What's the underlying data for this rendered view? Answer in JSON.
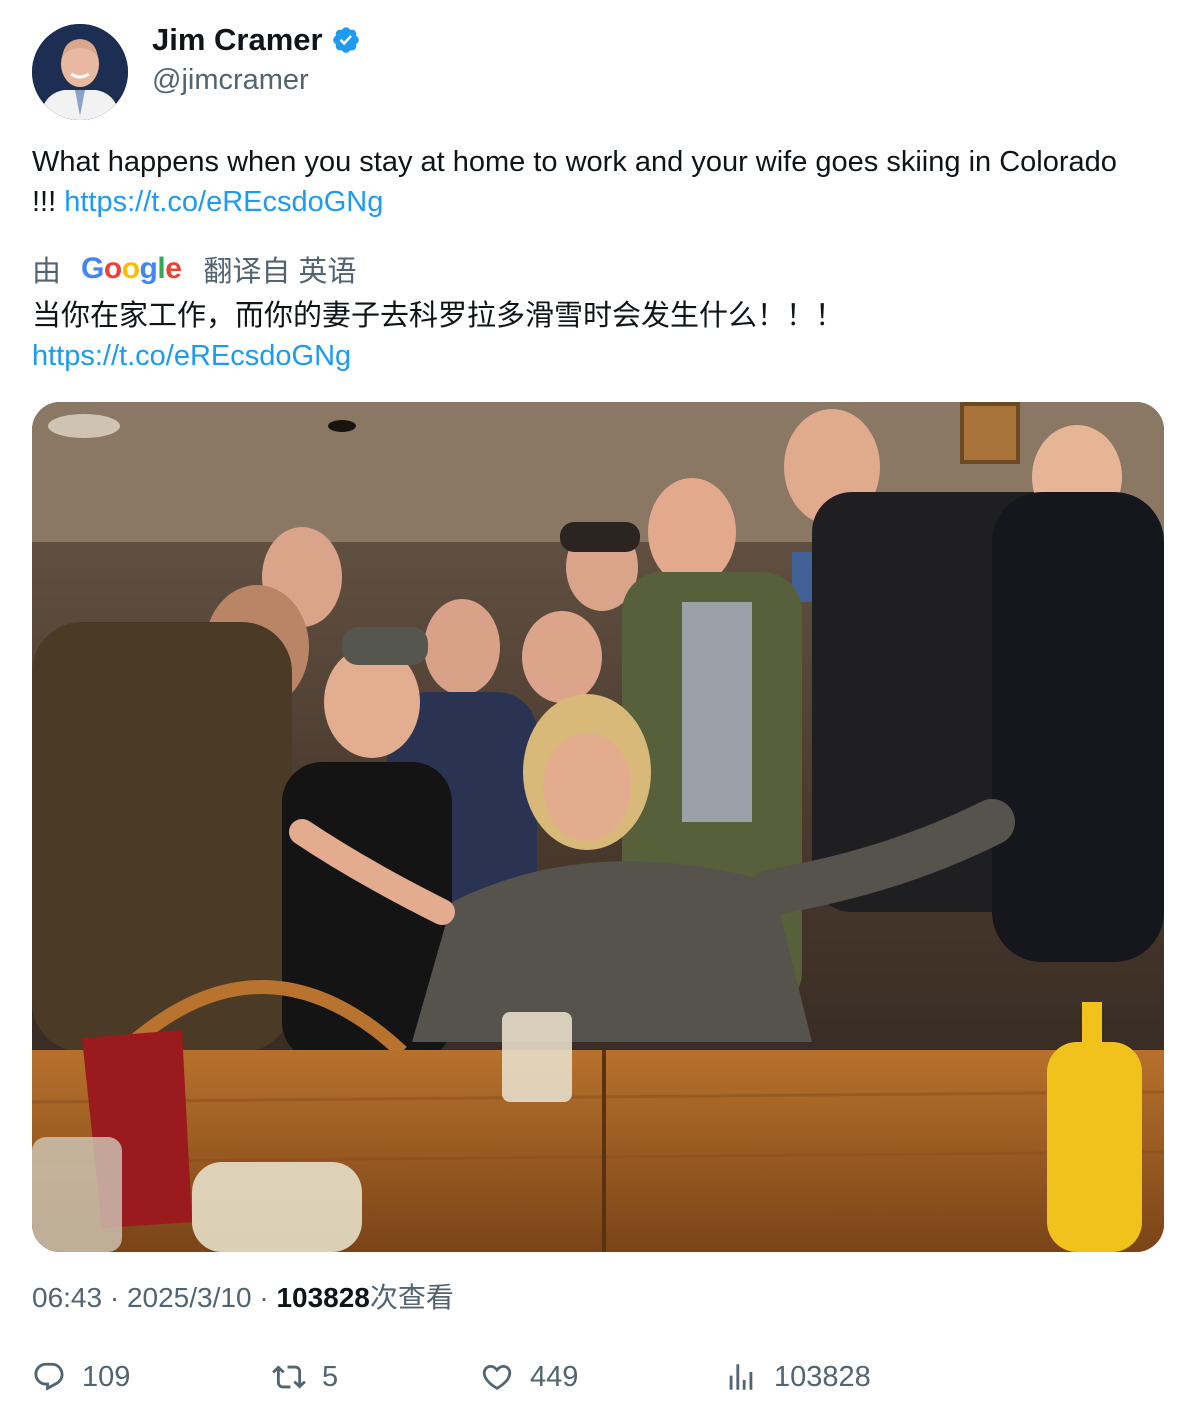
{
  "author": {
    "name": "Jim Cramer",
    "handle": "@jimcramer",
    "verified": true,
    "avatar_icon": "avatar"
  },
  "tweet": {
    "text": "What happens when you stay at home to work and your wife goes skiing in Colorado !!! ",
    "link": "https://t.co/eREcsdoGNg"
  },
  "translation": {
    "prefix": "由",
    "provider": "Google",
    "suffix": "翻译自 英语",
    "text": "当你在家工作，而你的妻子去科罗拉多滑雪时会发生什么！！！",
    "link": "https://t.co/eREcsdoGNg"
  },
  "meta": {
    "time": "06:43",
    "sep1": " · ",
    "date": "2025/3/10",
    "sep2": " · ",
    "views": "103828",
    "views_label": "次查看"
  },
  "actions": {
    "replies": "109",
    "retweets": "5",
    "likes": "449",
    "views": "103828"
  },
  "colors": {
    "link": "#1d9bf0",
    "secondary": "#536471",
    "verified": "#1d9bf0"
  }
}
